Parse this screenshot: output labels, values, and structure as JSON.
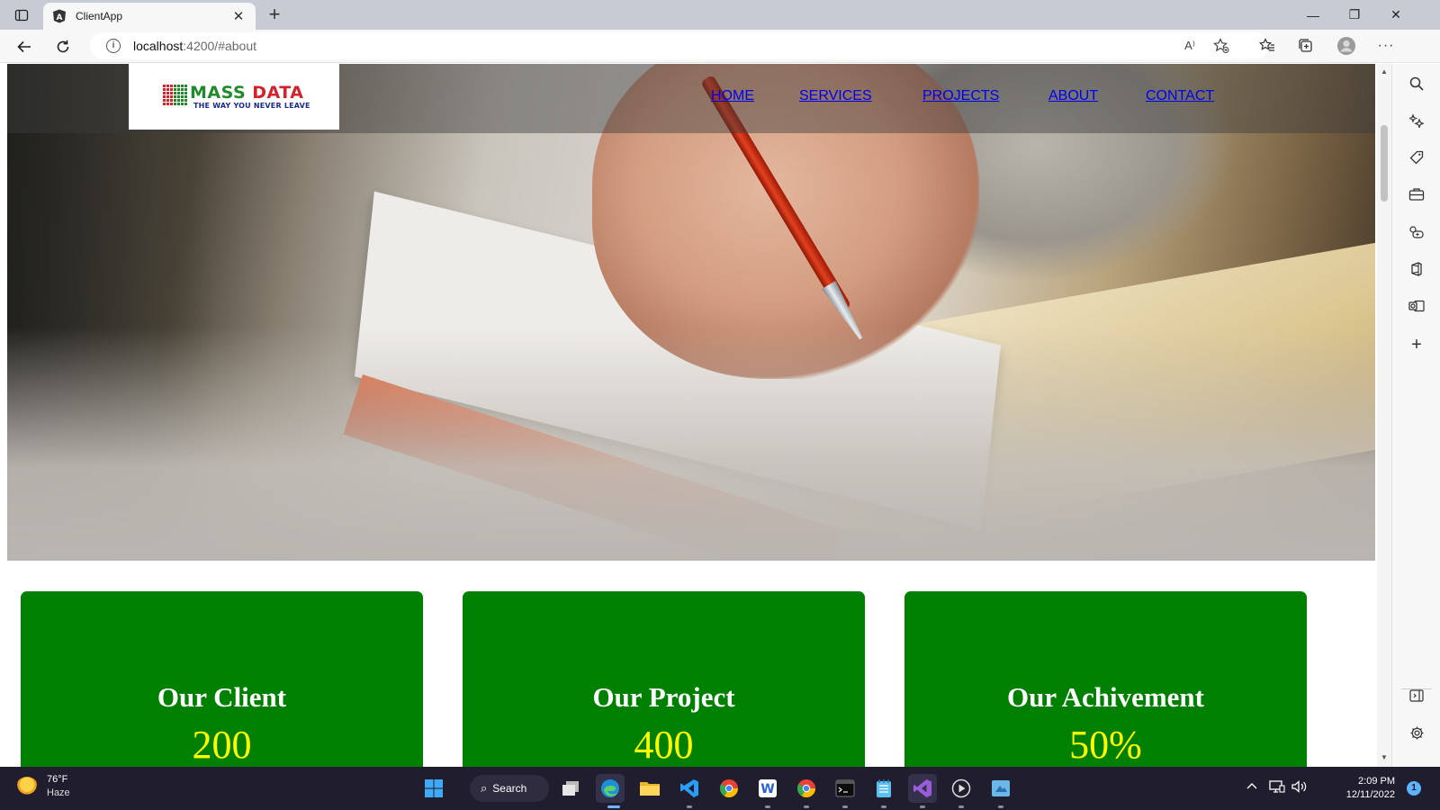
{
  "browser": {
    "tab": {
      "title": "ClientApp",
      "close": "✕"
    },
    "new_tab": "+",
    "window_controls": {
      "minimize": "—",
      "restore": "❐",
      "close": "✕"
    },
    "url": {
      "host": "localhost",
      "rest": ":4200/#about"
    },
    "read_aloud": "A⁾"
  },
  "site": {
    "logo": {
      "line1": "MASS",
      "line2": "DATA",
      "tagline": "THE WAY YOU NEVER LEAVE"
    },
    "nav": [
      "HOME",
      "SERVICES",
      "PROJECTS",
      "ABOUT",
      "CONTACT"
    ],
    "stats": [
      {
        "title": "Our Client",
        "value": "200"
      },
      {
        "title": "Our Project",
        "value": "400"
      },
      {
        "title": "Our Achivement",
        "value": "50%"
      }
    ],
    "colors": {
      "card_bg": "#008000",
      "card_title": "#ffffff",
      "card_value": "#ffff00"
    }
  },
  "taskbar": {
    "weather": {
      "temp": "76°F",
      "condition": "Haze"
    },
    "search_label": "Search",
    "clock": {
      "time": "2:09 PM",
      "date": "12/11/2022"
    },
    "notification_count": "1"
  }
}
